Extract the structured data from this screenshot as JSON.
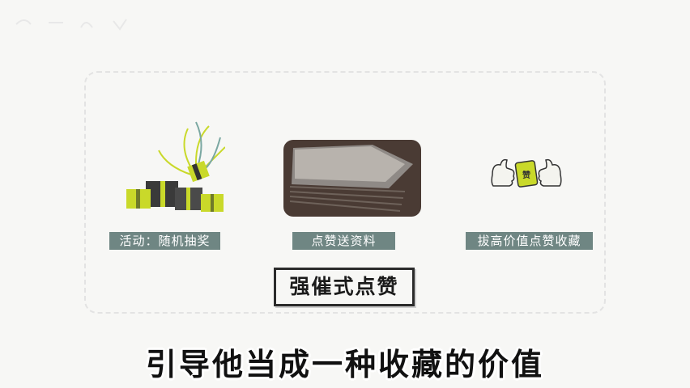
{
  "items": [
    {
      "label": "活动：随机抽奖",
      "image_icon": "gift-boxes-icon"
    },
    {
      "label": "点赞送资料",
      "image_icon": "paper-stack-icon"
    },
    {
      "label": "拔高价值点赞收藏",
      "image_icon": "thumbs-up-icon"
    }
  ],
  "cta_label": "强催式点赞",
  "subtitle": "引导他当成一种收藏的价值",
  "colors": {
    "label_bg": "#6f8683",
    "accent_green": "#c9d92a",
    "paper_bg": "#4a3b34"
  }
}
